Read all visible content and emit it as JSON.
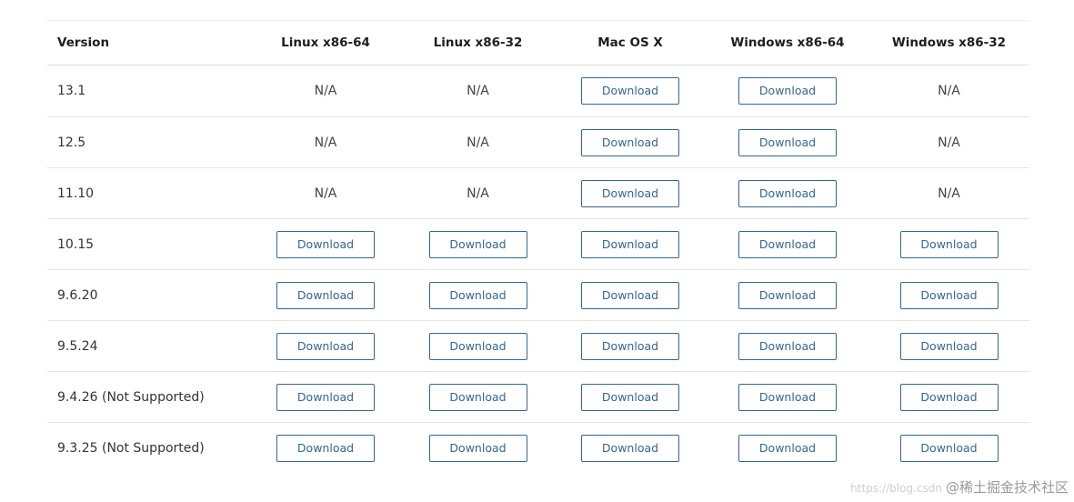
{
  "table": {
    "headers": [
      "Version",
      "Linux x86-64",
      "Linux x86-32",
      "Mac OS X",
      "Windows x86-64",
      "Windows x86-32"
    ],
    "button_label": "Download",
    "na_label": "N/A",
    "rows": [
      {
        "version": "13.1",
        "cells": [
          "N/A",
          "N/A",
          "Download",
          "Download",
          "N/A"
        ]
      },
      {
        "version": "12.5",
        "cells": [
          "N/A",
          "N/A",
          "Download",
          "Download",
          "N/A"
        ]
      },
      {
        "version": "11.10",
        "cells": [
          "N/A",
          "N/A",
          "Download",
          "Download",
          "N/A"
        ]
      },
      {
        "version": "10.15",
        "cells": [
          "Download",
          "Download",
          "Download",
          "Download",
          "Download"
        ]
      },
      {
        "version": "9.6.20",
        "cells": [
          "Download",
          "Download",
          "Download",
          "Download",
          "Download"
        ]
      },
      {
        "version": "9.5.24",
        "cells": [
          "Download",
          "Download",
          "Download",
          "Download",
          "Download"
        ]
      },
      {
        "version": "9.4.26 (Not Supported)",
        "cells": [
          "Download",
          "Download",
          "Download",
          "Download",
          "Download"
        ]
      },
      {
        "version": "9.3.25 (Not Supported)",
        "cells": [
          "Download",
          "Download",
          "Download",
          "Download",
          "Download"
        ]
      }
    ]
  },
  "colors": {
    "button_border": "#336791",
    "button_text": "#336791",
    "row_divider": "#e5e5e5"
  },
  "watermark": {
    "url": "https://blog.csdn",
    "name": "@稀土掘金技术社区"
  }
}
